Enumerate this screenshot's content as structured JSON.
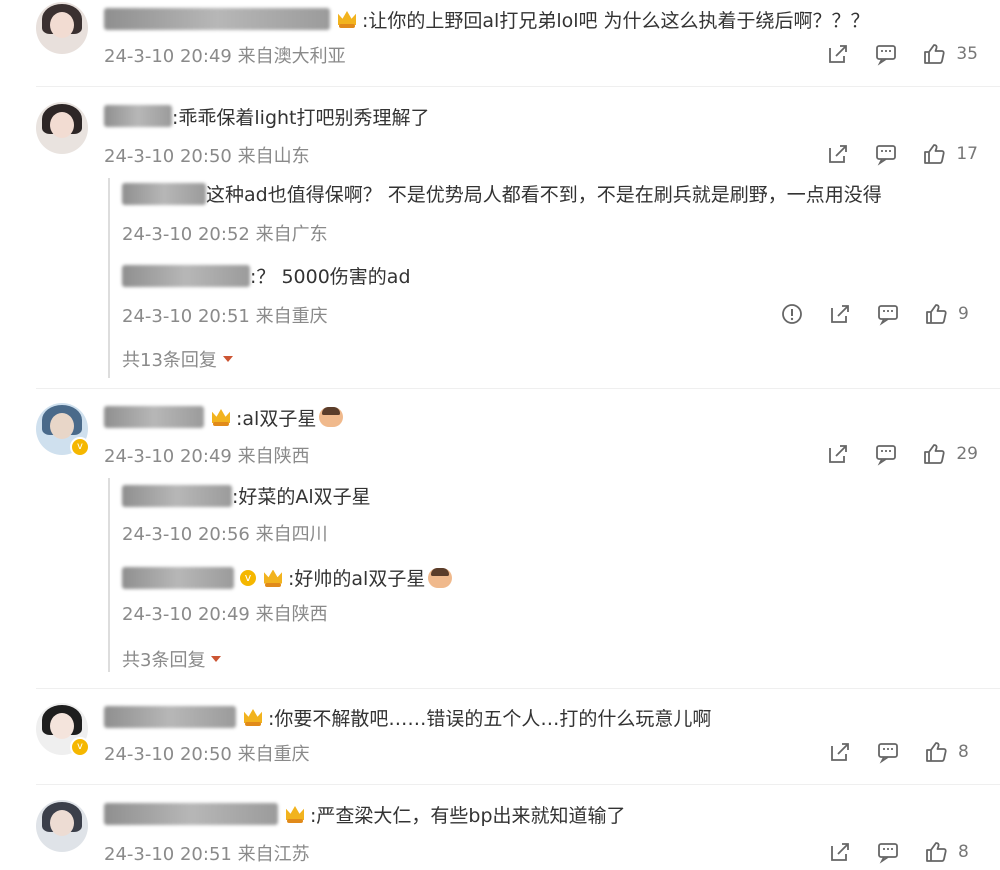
{
  "comments": [
    {
      "text": ":让你的上野回al打兄弟lol吧 为什么这么执着于绕后啊？？？",
      "meta": "24-3-10 20:49 来自澳大利亚",
      "likes": "35"
    },
    {
      "text": ":乖乖保着light打吧别秀理解了",
      "meta": "24-3-10 20:50 来自山东",
      "likes": "17",
      "replies": [
        {
          "text": "这种ad也值得保啊？ 不是优势局人都看不到，不是在刷兵就是刷野，一点用没得",
          "meta": "24-3-10 20:52 来自广东"
        },
        {
          "text": ":？ 5000伤害的ad",
          "meta": "24-3-10 20:51 来自重庆",
          "likes": "9"
        }
      ],
      "more": "共13条回复"
    },
    {
      "text": ":al双子星",
      "meta": "24-3-10 20:49 来自陕西",
      "likes": "29",
      "replies": [
        {
          "text": ":好菜的Al双子星",
          "meta": "24-3-10 20:56 来自四川"
        },
        {
          "text": ":好帅的al双子星",
          "meta": "24-3-10 20:49 来自陕西"
        }
      ],
      "more": "共3条回复"
    },
    {
      "text": ":你要不解散吧……错误的五个人…打的什么玩意儿啊",
      "meta": "24-3-10 20:50 来自重庆",
      "likes": "8"
    },
    {
      "text": ":严查梁大仁，有些bp出来就知道输了",
      "meta": "24-3-10 20:51 来自江苏",
      "likes": "8"
    }
  ],
  "icons": {
    "share": "share-icon",
    "comment": "comment-icon",
    "like": "like-icon",
    "report": "report-icon",
    "crown": "crown-icon",
    "vip": "vip-badge-icon",
    "caret": "caret-down-icon"
  },
  "colors": {
    "accent": "#f2b31e",
    "meta": "#8a8a8a",
    "caret": "#cc5533"
  }
}
